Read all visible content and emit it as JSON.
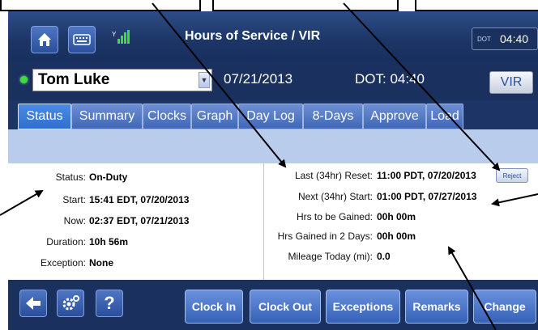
{
  "header": {
    "title": "Hours of Service / VIR",
    "icons": [
      "home-icon",
      "keyboard-icon",
      "signal-icon"
    ],
    "dot_clock": {
      "label": "DOT",
      "time": "04:40"
    }
  },
  "driver": {
    "name": "Tom Luke",
    "date": "07/21/2013",
    "dot_status": "DOT: 04:40",
    "vir_label": "VIR",
    "status_dot_color": "#3ddc3d"
  },
  "tabs": [
    {
      "label": "Status",
      "active": true
    },
    {
      "label": "Summary"
    },
    {
      "label": "Clocks"
    },
    {
      "label": "Graph"
    },
    {
      "label": "Day Log"
    },
    {
      "label": "8-Days"
    },
    {
      "label": "Approve"
    },
    {
      "label": "Load"
    }
  ],
  "status": {
    "status_label": "Status:",
    "status_value": "On-Duty",
    "start_label": "Start:",
    "start_value": "15:41 EDT, 07/20/2013",
    "now_label": "Now:",
    "now_value": "02:37 EDT, 07/21/2013",
    "duration_label": "Duration:",
    "duration_value": "10h 56m",
    "exception_label": "Exception:",
    "exception_value": "None"
  },
  "reset": {
    "last_label": "Last (34hr) Reset:",
    "last_value": "11:00 PDT, 07/20/2013",
    "reject_label": "Reject",
    "next_label": "Next (34hr) Start:",
    "next_value": "01:00 PDT, 07/27/2013",
    "gained_label": "Hrs to be Gained:",
    "gained_value": "00h 00m",
    "gained2_label": "Hrs Gained in 2 Days:",
    "gained2_value": "00h 00m",
    "mileage_label": "Mileage Today (mi):",
    "mileage_value": "0.0"
  },
  "bottom": {
    "help_label": "?",
    "buttons": [
      "Clock In",
      "Clock Out",
      "Exceptions",
      "Remarks",
      "Change"
    ]
  },
  "colors": {
    "header_bg": "#1c3566",
    "tab_active": "#2f6fd0",
    "tab": "#4068b7",
    "band": "#b9cceb"
  }
}
